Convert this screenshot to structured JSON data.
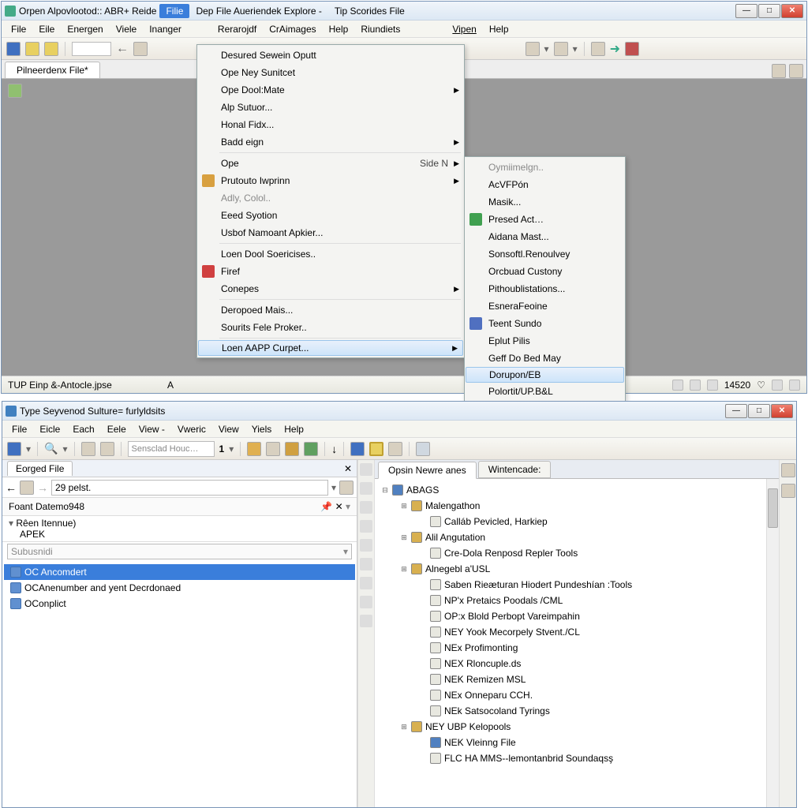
{
  "w1": {
    "title": "Orpen Alpovlootod:: ABR+ Reide",
    "top_tabs": [
      "Filie",
      "Dep File Aueriendek Explore -",
      "Tip Scorides File"
    ],
    "menubar": [
      "File",
      "Eile",
      "Energen",
      "Viele",
      "Inanger",
      "Rerarojdf",
      "CrAimages",
      "Help",
      "Riundiets",
      "Vipen",
      "Help"
    ],
    "doc_tab": "Pilneerdenx File*",
    "status_left": "TUP Einp &-Antocle.jpse",
    "status_mark": "A",
    "status_num": "14520",
    "menu": [
      {
        "t": "Desured Sewein Oputt"
      },
      {
        "t": "Ope Ney Sunitcet"
      },
      {
        "t": "Ope Dool:Mate",
        "arr": true
      },
      {
        "t": "Alp Sutuor..."
      },
      {
        "t": "Honal Fidx..."
      },
      {
        "t": "Badd eign",
        "arr": true
      },
      {
        "sep": true
      },
      {
        "t": "Ope",
        "sc": "Side N",
        "arr": true
      },
      {
        "t": "Prutouto Iwprinn",
        "arr": true,
        "ico": "#d8a040"
      },
      {
        "t": "Adly, Colol..",
        "dim": true
      },
      {
        "t": "Eeed Syotion"
      },
      {
        "t": "Usbof Namoant Apkier..."
      },
      {
        "sep": true
      },
      {
        "t": "Loen Dool Soericises.."
      },
      {
        "t": "Firef",
        "ico": "#d04040"
      },
      {
        "t": "Conepes",
        "arr": true
      },
      {
        "sep": true
      },
      {
        "t": "Deropoed Mais..."
      },
      {
        "t": "Sourits Fele Proker.."
      },
      {
        "sep": true
      },
      {
        "t": "Loen AAPP Curpet...",
        "arr": true,
        "hover": true
      }
    ],
    "submenu": [
      {
        "t": "Oymiimelgn..",
        "dim": true
      },
      {
        "t": "AcVFPón"
      },
      {
        "t": "Masik..."
      },
      {
        "t": "Presed Act…",
        "ico": "#40a050"
      },
      {
        "t": "Aidana Mast..."
      },
      {
        "t": "Sonsoftl.Renoulvey"
      },
      {
        "t": "Orcbuad Custony"
      },
      {
        "t": "Pithoublistations..."
      },
      {
        "t": "EsneraFeoine"
      },
      {
        "t": "Teent Sundo",
        "ico": "#5070c0"
      },
      {
        "t": "Eplut Pilis"
      },
      {
        "t": "Geff Do Bed May"
      },
      {
        "t": "Dorupon/EB",
        "hover": true
      },
      {
        "t": "Polortit/UP.B&L"
      }
    ]
  },
  "w2": {
    "title": "Type Seyvenod Sulture= furlyldsits",
    "menubar": [
      "File",
      "Eicle",
      "Each",
      "Eele",
      "View -",
      "Vweric",
      "View",
      "Yiels",
      "Help"
    ],
    "search_placeholder": "Sensclad Houc…",
    "search_num": "1",
    "left_tab": "Eorged File",
    "addr_value": "29 pelst.",
    "sub_header": "Foant Datemo948",
    "tree_header1": "Rêen Itennue)",
    "tree_header2": "APEK",
    "tree_sub": "Subusnidi",
    "tree_items": [
      {
        "t": "OC Ancomdert",
        "sel": true,
        "ico": "blue"
      },
      {
        "t": "OCAnenumber and yent Decrdonaed",
        "ico": "blue"
      },
      {
        "t": "OConplict",
        "ico": "blue"
      }
    ],
    "rp_tabs": [
      "Opsin Newre anes",
      "Wintencade:"
    ],
    "rp_tree": [
      {
        "l": 0,
        "t": "ABAGS",
        "exp": "−",
        "ico": "root"
      },
      {
        "l": 1,
        "t": "Malengathon",
        "exp": "+",
        "ico": "grp"
      },
      {
        "l": 2,
        "t": "Calláb Pevicled, Harkiep",
        "ico": "doc"
      },
      {
        "l": 1,
        "t": "Alil Angutation",
        "exp": "+",
        "ico": "grp"
      },
      {
        "l": 2,
        "t": "Cre-Dola Renposd Repler Tools",
        "ico": "doc"
      },
      {
        "l": 1,
        "t": "Alnegebl a'USL",
        "exp": "+",
        "ico": "grp"
      },
      {
        "l": 2,
        "t": "Saben Rieæturan Hiodert Pundeshían :Tools",
        "ico": "doc"
      },
      {
        "l": 2,
        "t": "NP'x Pretaics Poodals /CML",
        "ico": "doc"
      },
      {
        "l": 2,
        "t": "OP:x Blold Perbopt Vareimpahin",
        "ico": "doc"
      },
      {
        "l": 2,
        "t": "NEY Yook Mecorpely Stvent./CL",
        "ico": "doc"
      },
      {
        "l": 2,
        "t": "NEx Profimonting",
        "ico": "doc"
      },
      {
        "l": 2,
        "t": "NEX Rloncuple.ds",
        "ico": "doc"
      },
      {
        "l": 2,
        "t": "NEK Remizen MSL",
        "ico": "doc"
      },
      {
        "l": 2,
        "t": "NEx Onneparu CCH.",
        "ico": "doc"
      },
      {
        "l": 2,
        "t": "NEk Satsocoland Tyrings",
        "ico": "doc"
      },
      {
        "l": 1,
        "t": "NEY UBP Kelopools",
        "exp": "+",
        "ico": "grp"
      },
      {
        "l": 2,
        "t": "NEK Vleinng File",
        "ico": "root"
      },
      {
        "l": 2,
        "t": "FLC HA MMS--lemontanbrid Soundaqsş",
        "ico": "doc"
      }
    ]
  }
}
